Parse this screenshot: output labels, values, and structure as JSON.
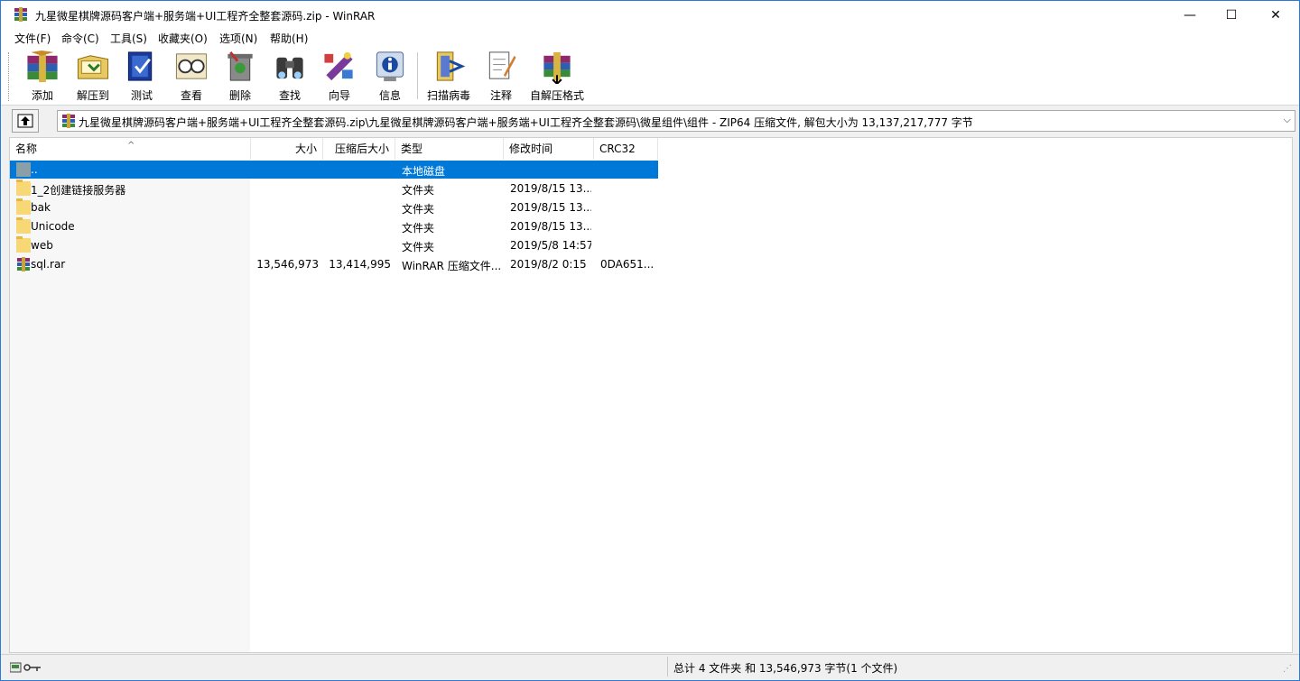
{
  "window": {
    "title": "九星微星棋牌源码客户端+服务端+UI工程齐全整套源码.zip - WinRAR",
    "minimize_glyph": "—",
    "maximize_glyph": "☐",
    "close_glyph": "✕"
  },
  "menu": [
    "文件(F)",
    "命令(C)",
    "工具(S)",
    "收藏夹(O)",
    "选项(N)",
    "帮助(H)"
  ],
  "toolbar": {
    "buttons": [
      {
        "label": "添加",
        "icon": "add-archive-icon"
      },
      {
        "label": "解压到",
        "icon": "extract-to-icon"
      },
      {
        "label": "测试",
        "icon": "test-icon"
      },
      {
        "label": "查看",
        "icon": "view-icon"
      },
      {
        "label": "删除",
        "icon": "delete-icon"
      },
      {
        "label": "查找",
        "icon": "find-icon"
      },
      {
        "label": "向导",
        "icon": "wizard-icon"
      },
      {
        "label": "信息",
        "icon": "info-icon"
      },
      {
        "label": "扫描病毒",
        "icon": "virus-scan-icon"
      },
      {
        "label": "注释",
        "icon": "comment-icon"
      },
      {
        "label": "自解压格式",
        "icon": "sfx-icon"
      }
    ]
  },
  "address": {
    "path": "九星微星棋牌源码客户端+服务端+UI工程齐全整套源码.zip\\九星微星棋牌源码客户端+服务端+UI工程齐全整套源码\\微星组件\\组件 - ZIP64 压缩文件, 解包大小为 13,137,217,777 字节",
    "dropdown_glyph": "⌵"
  },
  "columns": {
    "name": "名称",
    "size": "大小",
    "packed": "压缩后大小",
    "type": "类型",
    "modified": "修改时间",
    "crc": "CRC32"
  },
  "files": [
    {
      "name": "..",
      "size": "",
      "packed": "",
      "type": "本地磁盘",
      "modified": "",
      "crc": "",
      "kind": "parent",
      "selected": true
    },
    {
      "name": "1_2创建链接服务器",
      "size": "",
      "packed": "",
      "type": "文件夹",
      "modified": "2019/8/15 13...",
      "crc": "",
      "kind": "folder",
      "selected": false
    },
    {
      "name": "bak",
      "size": "",
      "packed": "",
      "type": "文件夹",
      "modified": "2019/8/15 13...",
      "crc": "",
      "kind": "folder",
      "selected": false
    },
    {
      "name": "Unicode",
      "size": "",
      "packed": "",
      "type": "文件夹",
      "modified": "2019/8/15 13...",
      "crc": "",
      "kind": "folder",
      "selected": false
    },
    {
      "name": "web",
      "size": "",
      "packed": "",
      "type": "文件夹",
      "modified": "2019/5/8 14:57",
      "crc": "",
      "kind": "folder",
      "selected": false
    },
    {
      "name": "sql.rar",
      "size": "13,546,973",
      "packed": "13,414,995",
      "type": "WinRAR 压缩文件...",
      "modified": "2019/8/2 0:15",
      "crc": "0DA651...",
      "kind": "rar",
      "selected": false
    }
  ],
  "status": {
    "text": "总计 4 文件夹 和 13,546,973 字节(1 个文件)"
  }
}
